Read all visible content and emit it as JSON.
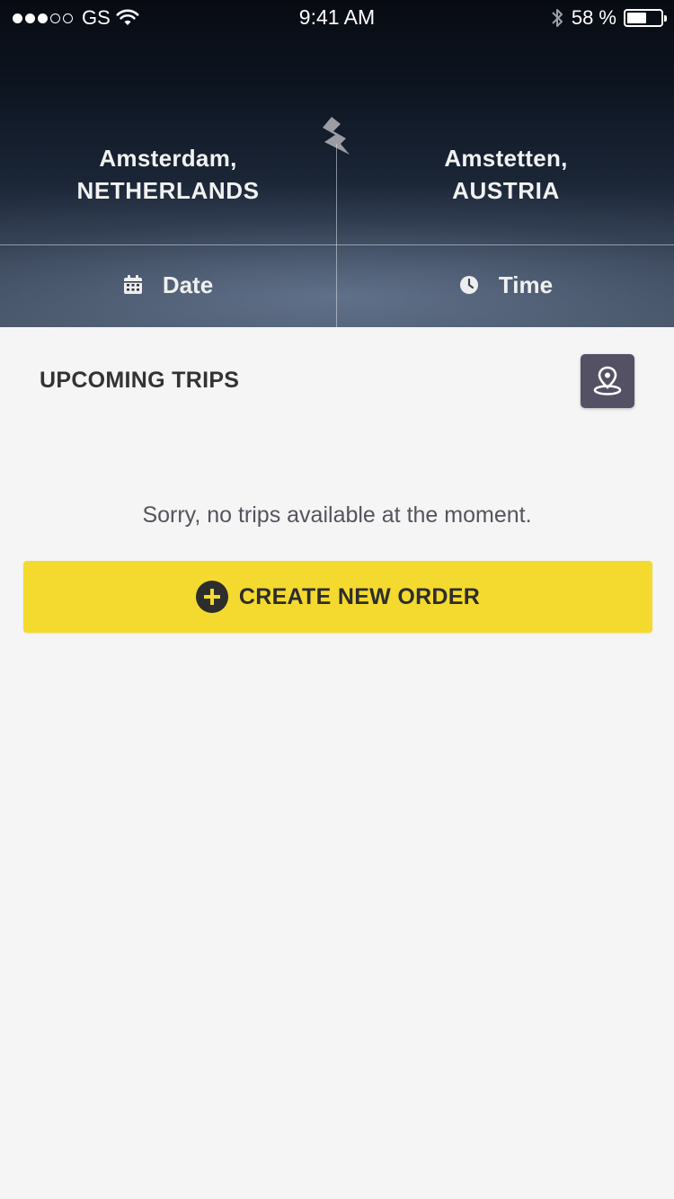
{
  "status_bar": {
    "carrier": "GS",
    "time": "9:41 AM",
    "battery": "58 %",
    "battery_level": 0.58,
    "signal_bars_filled": 3,
    "signal_bars_total": 5
  },
  "route": {
    "from": {
      "city": "Amsterdam,",
      "country": "NETHERLANDS"
    },
    "to": {
      "city": "Amstetten,",
      "country": "AUSTRIA"
    }
  },
  "pickers": {
    "date_label": "Date",
    "time_label": "Time"
  },
  "trips": {
    "title": "UPCOMING TRIPS",
    "empty_message": "Sorry, no trips available at the moment.",
    "create_label": "CREATE NEW ORDER"
  },
  "icons": {
    "signal": "signal-dots-icon",
    "wifi": "wifi-icon",
    "bluetooth": "bluetooth-icon",
    "battery": "battery-icon",
    "route": "lightning-bolt-icon",
    "date": "calendar-icon",
    "time": "clock-icon",
    "map": "map-pin-icon",
    "create": "plus-circle-icon"
  },
  "colors": {
    "accent_yellow": "#f4da2e",
    "map_button": "#555165",
    "background": "#f5f5f5"
  }
}
